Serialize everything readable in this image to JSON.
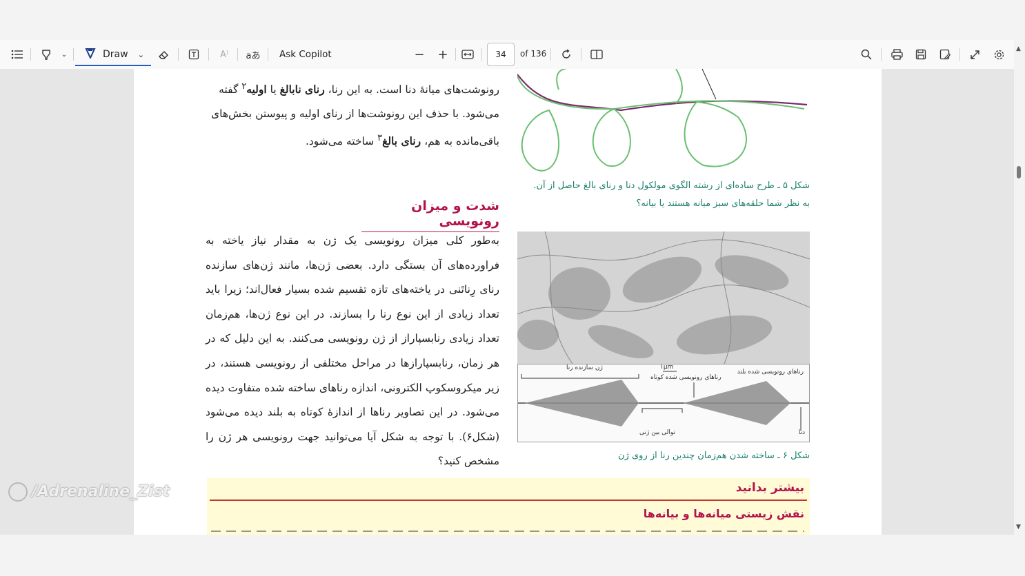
{
  "toolbar": {
    "draw_label": "Draw",
    "ask_copilot": "Ask Copilot",
    "page_current": "34",
    "page_total": "of 136"
  },
  "page": {
    "para1_l1": "رونوشت‌های میانهٔ دنا است. به این رنا، ",
    "para1_bold1": "رنای نابالغ",
    "para1_mid": " یا ",
    "para1_bold2": "اولیه",
    "para1_sup": "۲",
    "para1_end": " گفته",
    "para1_l2": "می‌شود. با حذف این رونوشت‌ها از رنای اولیه و پیوستن بخش‌های",
    "para1_l3a": "باقی‌مانده به هم، ",
    "para1_bold3": "رنای بالغ",
    "para1_sup3": "۳",
    "para1_l3b": " ساخته می‌شود.",
    "heading": "شدت و میزان رونویسی",
    "para2": "به‌طور کلی میزان رونویسی یک ژن به مقدار نیاز یاخته به فراورده‌های آن بستگی دارد. بعضی ژن‌ها، مانند ژن‌های سازنده رنای رِناتَنی در یاخته‌های تازه تقسیم شده بسیار فعال‌اند؛ زیرا باید تعداد زیادی از این نوع رنا را بسازند. در این نوع ژن‌ها، هم‌زمان تعداد زیادی رنابسپاراز از ژن رونویسی می‌کنند. به این دلیل که در هر زمان، رنابسپارازها در مراحل مختلفی از رونویسی هستند، در زیر میکروسکوپ الکترونی، اندازه رناهای ساخته شده متفاوت دیده می‌شود. در این تصاویر رناها از اندازهٔ کوتاه به بلند دیده می‌شود (شکل۶). با توجه به شکل آیا می‌توانید جهت رونویسی هر ژن را مشخص کنید؟",
    "caption5_line1": "شکل ۵ ـ طرح ساده‌ای از رشته الگوی مولکول دنا و رنای بالغ حاصل از آن.",
    "caption5_line2": "به نظر شما حلقه‌های سبز میانه هستند یا بیانه؟",
    "caption6": "شکل ۶ ـ ساخته شدن هم‌زمان چندین رنا از روی ژن",
    "fig6_labels": {
      "gene": "ژن سازنده رنا",
      "long": "رناهای رونویسی شده بلند",
      "scale": "۱μm",
      "short": "رناهای رونویسی شده کوتاه",
      "spacer": "توالی بین ژنی",
      "dna": "دنا"
    },
    "box_title": "بیشتر بدانید",
    "box_subtitle": "نقش زیستی میانه‌ها و بیانه‌ها"
  },
  "watermark": "/Adrenaline_Zist"
}
